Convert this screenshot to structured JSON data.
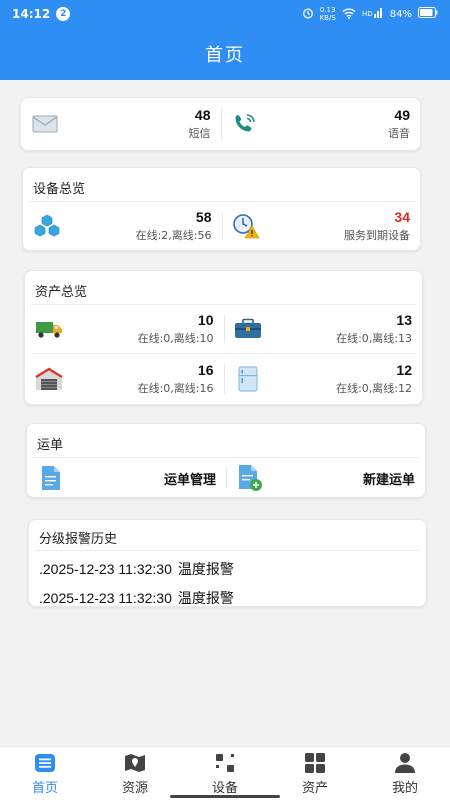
{
  "status_bar": {
    "time": "14:12",
    "notification_count": "2",
    "speed_value": "0.13",
    "speed_unit": "KB/S",
    "battery": "84%"
  },
  "header": {
    "title": "首页"
  },
  "messages": {
    "sms_count": "48",
    "sms_label": "短信",
    "voice_count": "49",
    "voice_label": "语音"
  },
  "device_overview": {
    "title": "设备总览",
    "total": "58",
    "total_status": "在线:2,离线:56",
    "expiring": "34",
    "expiring_label": "服务到期设备"
  },
  "asset_overview": {
    "title": "资产总览",
    "items": [
      {
        "icon": "truck-icon",
        "value": "10",
        "status": "在线:0,离线:10"
      },
      {
        "icon": "toolbox-icon",
        "value": "13",
        "status": "在线:0,离线:13"
      },
      {
        "icon": "warehouse-icon",
        "value": "16",
        "status": "在线:0,离线:16"
      },
      {
        "icon": "fridge-icon",
        "value": "12",
        "status": "在线:0,离线:12"
      }
    ]
  },
  "waybill": {
    "title": "运单",
    "manage_label": "运单管理",
    "create_label": "新建运单"
  },
  "alarm_history": {
    "title": "分级报警历史",
    "entries": [
      {
        "time": ".2025-12-23 11:32:30",
        "text": "温度报警"
      },
      {
        "time": ".2025-12-23 11:32:30",
        "text": "温度报警"
      }
    ]
  },
  "tabs": [
    {
      "label": "首页",
      "icon": "home-list-icon",
      "active": true
    },
    {
      "label": "资源",
      "icon": "map-pin-icon",
      "active": false
    },
    {
      "label": "设备",
      "icon": "device-icon",
      "active": false
    },
    {
      "label": "资产",
      "icon": "grid-icon",
      "active": false
    },
    {
      "label": "我的",
      "icon": "user-icon",
      "active": false
    }
  ],
  "colors": {
    "primary": "#2f8ef3",
    "alert_red": "#e02a2a"
  }
}
